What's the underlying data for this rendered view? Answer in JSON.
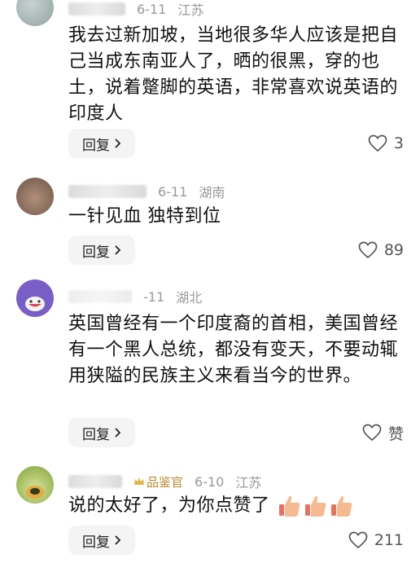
{
  "comments": [
    {
      "date": "6-11",
      "location": "江苏",
      "text": "我去过新加坡，当地很多华人应该是把自己当成东南亚人了，晒的很黑，穿的也土，说着蹩脚的英语，非常喜欢说英语的印度人",
      "reply_label": "回复",
      "likes": "3"
    },
    {
      "date": "6-11",
      "location": "湖南",
      "text": "一针见血 独特到位",
      "reply_label": "回复",
      "likes": "89"
    },
    {
      "date": "-11",
      "location": "湖北",
      "text": "英国曾经有一个印度裔的首相，美国曾经有一个黑人总统，都没有变天，不要动辄用狭隘的民族主义来看当今的世界。",
      "reply_label": "回复",
      "likes": "赞"
    },
    {
      "badge": "品鉴官",
      "date": "6-10",
      "location": "江苏",
      "text": "说的太好了，为你点赞了",
      "reply_label": "回复",
      "likes": "211"
    }
  ],
  "colors": {
    "meta": "#9a9a9a",
    "badge": "#b88a2a",
    "reply_bg": "#f4f4f4",
    "thumb": "#f2a07b"
  }
}
